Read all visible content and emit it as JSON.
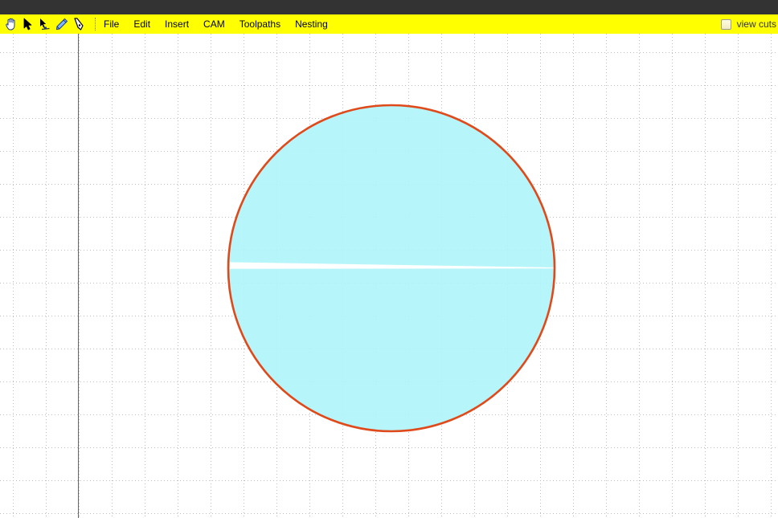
{
  "toolbar": {
    "tools": [
      {
        "name": "pan-tool",
        "icon": "hand-icon"
      },
      {
        "name": "select-tool",
        "icon": "arrow-pointer-icon"
      },
      {
        "name": "edit-nodes-tool",
        "icon": "node-pointer-icon"
      },
      {
        "name": "pencil-tool",
        "icon": "pencil-icon"
      },
      {
        "name": "pen-tool",
        "icon": "pen-nib-icon"
      }
    ],
    "background_color": "#ffff00"
  },
  "menu": {
    "file": "File",
    "edit": "Edit",
    "insert": "Insert",
    "cam": "CAM",
    "toolpaths": "Toolpaths",
    "nesting": "Nesting"
  },
  "view_cuts": {
    "label": "view cuts",
    "checked": false
  },
  "canvas": {
    "grid_color": "#c4c4c4",
    "axis_color": "#666666",
    "shape_fill": "#b0f4fa",
    "shape_stroke": "#e04a1a"
  }
}
